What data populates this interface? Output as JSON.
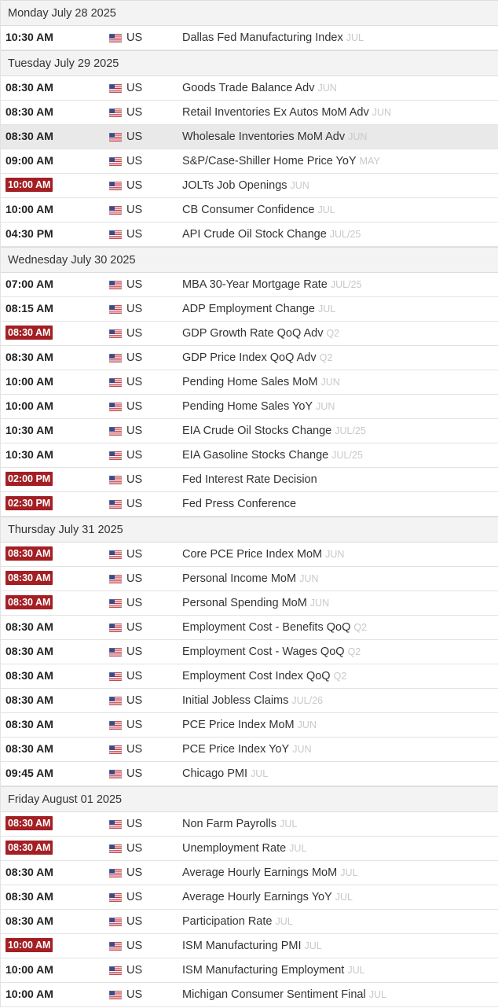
{
  "colors": {
    "highlight_time": "#a31f23",
    "day_header_bg": "#f3f3f3",
    "ref_text": "#c8c8c8"
  },
  "icon_flag": "us-flag-icon",
  "days": [
    {
      "label": "Monday July 28 2025",
      "events": [
        {
          "time": "10:30 AM",
          "country": "US",
          "name": "Dallas Fed Manufacturing Index",
          "ref": "JUL",
          "high": false
        }
      ]
    },
    {
      "label": "Tuesday July 29 2025",
      "events": [
        {
          "time": "08:30 AM",
          "country": "US",
          "name": "Goods Trade Balance Adv",
          "ref": "JUN",
          "high": false
        },
        {
          "time": "08:30 AM",
          "country": "US",
          "name": "Retail Inventories Ex Autos MoM Adv",
          "ref": "JUN",
          "high": false
        },
        {
          "time": "08:30 AM",
          "country": "US",
          "name": "Wholesale Inventories MoM Adv",
          "ref": "JUN",
          "high": false,
          "hover": true
        },
        {
          "time": "09:00 AM",
          "country": "US",
          "name": "S&P/Case-Shiller Home Price YoY",
          "ref": "MAY",
          "high": false
        },
        {
          "time": "10:00 AM",
          "country": "US",
          "name": "JOLTs Job Openings",
          "ref": "JUN",
          "high": true
        },
        {
          "time": "10:00 AM",
          "country": "US",
          "name": "CB Consumer Confidence",
          "ref": "JUL",
          "high": false
        },
        {
          "time": "04:30 PM",
          "country": "US",
          "name": "API Crude Oil Stock Change",
          "ref": "JUL/25",
          "high": false
        }
      ]
    },
    {
      "label": "Wednesday July 30 2025",
      "events": [
        {
          "time": "07:00 AM",
          "country": "US",
          "name": "MBA 30-Year Mortgage Rate",
          "ref": "JUL/25",
          "high": false
        },
        {
          "time": "08:15 AM",
          "country": "US",
          "name": "ADP Employment Change",
          "ref": "JUL",
          "high": false
        },
        {
          "time": "08:30 AM",
          "country": "US",
          "name": "GDP Growth Rate QoQ Adv",
          "ref": "Q2",
          "high": true
        },
        {
          "time": "08:30 AM",
          "country": "US",
          "name": "GDP Price Index QoQ Adv",
          "ref": "Q2",
          "high": false
        },
        {
          "time": "10:00 AM",
          "country": "US",
          "name": "Pending Home Sales MoM",
          "ref": "JUN",
          "high": false
        },
        {
          "time": "10:00 AM",
          "country": "US",
          "name": "Pending Home Sales YoY",
          "ref": "JUN",
          "high": false
        },
        {
          "time": "10:30 AM",
          "country": "US",
          "name": "EIA Crude Oil Stocks Change",
          "ref": "JUL/25",
          "high": false
        },
        {
          "time": "10:30 AM",
          "country": "US",
          "name": "EIA Gasoline Stocks Change",
          "ref": "JUL/25",
          "high": false
        },
        {
          "time": "02:00 PM",
          "country": "US",
          "name": "Fed Interest Rate Decision",
          "ref": "",
          "high": true
        },
        {
          "time": "02:30 PM",
          "country": "US",
          "name": "Fed Press Conference",
          "ref": "",
          "high": true
        }
      ]
    },
    {
      "label": "Thursday July 31 2025",
      "events": [
        {
          "time": "08:30 AM",
          "country": "US",
          "name": "Core PCE Price Index MoM",
          "ref": "JUN",
          "high": true
        },
        {
          "time": "08:30 AM",
          "country": "US",
          "name": "Personal Income MoM",
          "ref": "JUN",
          "high": true
        },
        {
          "time": "08:30 AM",
          "country": "US",
          "name": "Personal Spending MoM",
          "ref": "JUN",
          "high": true
        },
        {
          "time": "08:30 AM",
          "country": "US",
          "name": "Employment Cost - Benefits QoQ",
          "ref": "Q2",
          "high": false
        },
        {
          "time": "08:30 AM",
          "country": "US",
          "name": "Employment Cost - Wages QoQ",
          "ref": "Q2",
          "high": false
        },
        {
          "time": "08:30 AM",
          "country": "US",
          "name": "Employment Cost Index QoQ",
          "ref": "Q2",
          "high": false
        },
        {
          "time": "08:30 AM",
          "country": "US",
          "name": "Initial Jobless Claims",
          "ref": "JUL/26",
          "high": false
        },
        {
          "time": "08:30 AM",
          "country": "US",
          "name": "PCE Price Index MoM",
          "ref": "JUN",
          "high": false
        },
        {
          "time": "08:30 AM",
          "country": "US",
          "name": "PCE Price Index YoY",
          "ref": "JUN",
          "high": false
        },
        {
          "time": "09:45 AM",
          "country": "US",
          "name": "Chicago PMI",
          "ref": "JUL",
          "high": false
        }
      ]
    },
    {
      "label": "Friday August 01 2025",
      "events": [
        {
          "time": "08:30 AM",
          "country": "US",
          "name": "Non Farm Payrolls",
          "ref": "JUL",
          "high": true
        },
        {
          "time": "08:30 AM",
          "country": "US",
          "name": "Unemployment Rate",
          "ref": "JUL",
          "high": true
        },
        {
          "time": "08:30 AM",
          "country": "US",
          "name": "Average Hourly Earnings MoM",
          "ref": "JUL",
          "high": false
        },
        {
          "time": "08:30 AM",
          "country": "US",
          "name": "Average Hourly Earnings YoY",
          "ref": "JUL",
          "high": false
        },
        {
          "time": "08:30 AM",
          "country": "US",
          "name": "Participation Rate",
          "ref": "JUL",
          "high": false
        },
        {
          "time": "10:00 AM",
          "country": "US",
          "name": "ISM Manufacturing PMI",
          "ref": "JUL",
          "high": true
        },
        {
          "time": "10:00 AM",
          "country": "US",
          "name": "ISM Manufacturing Employment",
          "ref": "JUL",
          "high": false
        },
        {
          "time": "10:00 AM",
          "country": "US",
          "name": "Michigan Consumer Sentiment Final",
          "ref": "JUL",
          "high": false
        }
      ]
    }
  ]
}
